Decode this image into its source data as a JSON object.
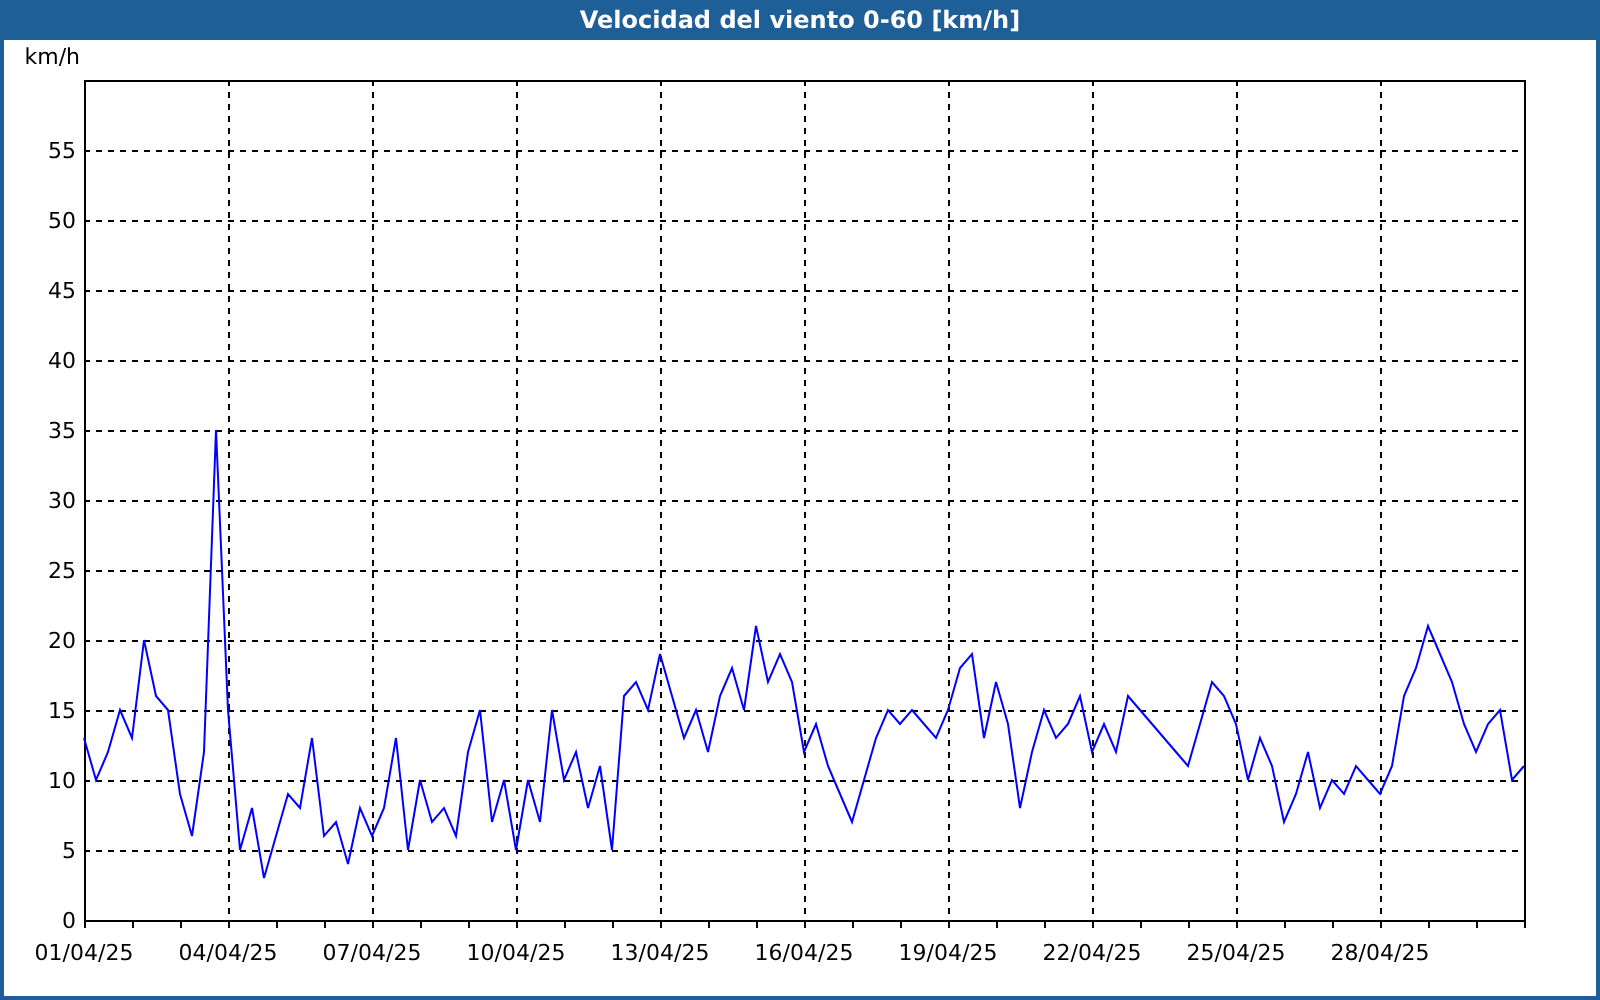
{
  "window": {
    "title": "Velocidad del viento 0-60 [km/h]"
  },
  "chart": {
    "chart_data": {
      "type": "line",
      "grid": true,
      "ylabel": "km/h",
      "ylim": [
        0,
        60
      ],
      "yticks": [
        0,
        5,
        10,
        15,
        20,
        25,
        30,
        35,
        40,
        45,
        50,
        55
      ],
      "categories": [
        "01/04/25",
        null,
        null,
        null,
        null,
        null,
        null,
        null,
        null,
        null,
        null,
        null,
        "04/04/25",
        null,
        null,
        null,
        null,
        null,
        null,
        null,
        null,
        null,
        null,
        null,
        "07/04/25",
        null,
        null,
        null,
        null,
        null,
        null,
        null,
        null,
        null,
        null,
        null,
        "10/04/25",
        null,
        null,
        null,
        null,
        null,
        null,
        null,
        null,
        null,
        null,
        null,
        "13/04/25",
        null,
        null,
        null,
        null,
        null,
        null,
        null,
        null,
        null,
        null,
        null,
        "16/04/25",
        null,
        null,
        null,
        null,
        null,
        null,
        null,
        null,
        null,
        null,
        null,
        "19/04/25",
        null,
        null,
        null,
        null,
        null,
        null,
        null,
        null,
        null,
        null,
        null,
        "22/04/25",
        null,
        null,
        null,
        null,
        null,
        null,
        null,
        null,
        null,
        null,
        null,
        "25/04/25",
        null,
        null,
        null,
        null,
        null,
        null,
        null,
        null,
        null,
        null,
        null,
        "28/04/25",
        null,
        null,
        null,
        null,
        null,
        null,
        null,
        null,
        null,
        null,
        null,
        null
      ],
      "series": [
        {
          "color": "#0000ff",
          "values": [
            13,
            10,
            12,
            15,
            13,
            20,
            16,
            15,
            9,
            6,
            12,
            35,
            15,
            5,
            8,
            3,
            6,
            9,
            8,
            13,
            6,
            7,
            4,
            8,
            6,
            8,
            13,
            5,
            10,
            7,
            8,
            6,
            12,
            15,
            7,
            10,
            5,
            10,
            7,
            15,
            10,
            12,
            8,
            11,
            5,
            16,
            17,
            15,
            19,
            16,
            13,
            15,
            12,
            16,
            18,
            15,
            21,
            17,
            19,
            17,
            12,
            14,
            11,
            9,
            7,
            10,
            13,
            15,
            14,
            15,
            14,
            13,
            15,
            18,
            19,
            13,
            17,
            14,
            8,
            12,
            15,
            13,
            14,
            16,
            12,
            14,
            12,
            16,
            15,
            14,
            13,
            12,
            11,
            14,
            17,
            16,
            14,
            10,
            13,
            11,
            7,
            9,
            12,
            8,
            10,
            9,
            11,
            10,
            9,
            11,
            16,
            18,
            21,
            19,
            17,
            14,
            12,
            14,
            15,
            10,
            11
          ]
        }
      ]
    }
  }
}
